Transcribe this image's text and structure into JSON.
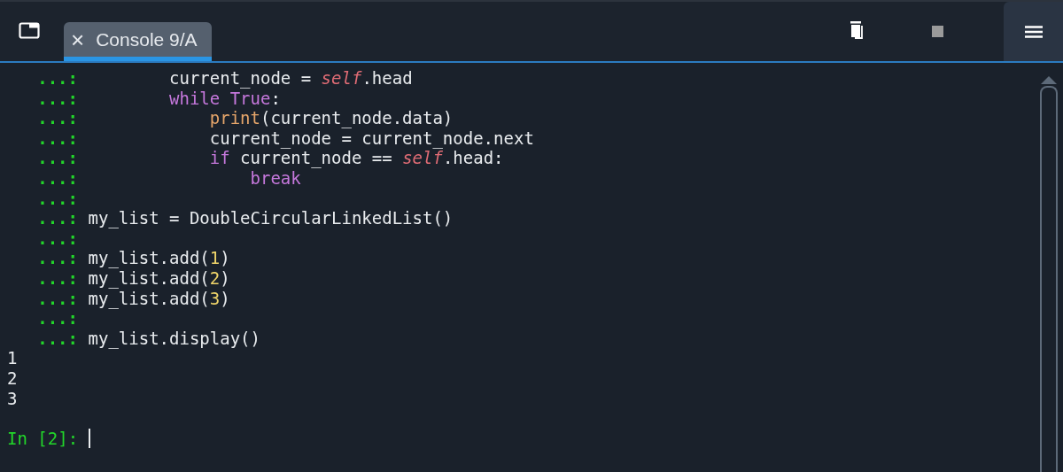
{
  "tabs": [
    {
      "label": "Console 9/A",
      "selected": true,
      "close": "×"
    }
  ],
  "console": {
    "lines": [
      {
        "kind": "input",
        "prompt": "...:",
        "tokens": [
          {
            "text": "        current_node = ",
            "kind": "plain"
          },
          {
            "text": "self",
            "kind": "self"
          },
          {
            "text": ".head",
            "kind": "plain"
          }
        ]
      },
      {
        "kind": "input",
        "prompt": "...:",
        "tokens": [
          {
            "text": "        while True",
            "kind": "keyword"
          },
          {
            "text": ":",
            "kind": "plain"
          }
        ]
      },
      {
        "kind": "input",
        "prompt": "...:",
        "tokens": [
          {
            "text": "            print",
            "kind": "builtin"
          },
          {
            "text": "(current_node.data)",
            "kind": "plain"
          }
        ]
      },
      {
        "kind": "input",
        "prompt": "...:",
        "tokens": [
          {
            "text": "            current_node = current_node.next",
            "kind": "plain"
          }
        ]
      },
      {
        "kind": "input",
        "prompt": "...:",
        "tokens": [
          {
            "text": "            if",
            "kind": "keyword"
          },
          {
            "text": " current_node == ",
            "kind": "plain"
          },
          {
            "text": "self",
            "kind": "self"
          },
          {
            "text": ".head:",
            "kind": "plain"
          }
        ]
      },
      {
        "kind": "input",
        "prompt": "...:",
        "tokens": [
          {
            "text": "                break",
            "kind": "keyword"
          }
        ]
      },
      {
        "kind": "input",
        "prompt": "...:"
      },
      {
        "kind": "input",
        "prompt": "...:",
        "tokens": [
          {
            "text": "my_list = DoubleCircularLinkedList()",
            "kind": "plain"
          }
        ]
      },
      {
        "kind": "input",
        "prompt": "...:"
      },
      {
        "kind": "input",
        "prompt": "...:",
        "tokens": [
          {
            "text": "my_list.add(",
            "kind": "plain"
          },
          {
            "text": "1",
            "kind": "number"
          },
          {
            "text": ")",
            "kind": "plain"
          }
        ]
      },
      {
        "kind": "input",
        "prompt": "...:",
        "tokens": [
          {
            "text": "my_list.add(",
            "kind": "plain"
          },
          {
            "text": "2",
            "kind": "number"
          },
          {
            "text": ")",
            "kind": "plain"
          }
        ]
      },
      {
        "kind": "input",
        "prompt": "...:",
        "tokens": [
          {
            "text": "my_list.add(",
            "kind": "plain"
          },
          {
            "text": "3",
            "kind": "number"
          },
          {
            "text": ")",
            "kind": "plain"
          }
        ]
      },
      {
        "kind": "input",
        "prompt": "...:"
      },
      {
        "kind": "input",
        "prompt": "...:",
        "tokens": [
          {
            "text": "my_list.display()",
            "kind": "plain"
          }
        ]
      },
      {
        "kind": "output",
        "text": "1"
      },
      {
        "kind": "output",
        "text": "2"
      },
      {
        "kind": "output",
        "text": "3"
      },
      {
        "kind": "blank"
      },
      {
        "kind": "prompt",
        "prompt": "In [2]:"
      }
    ]
  }
}
